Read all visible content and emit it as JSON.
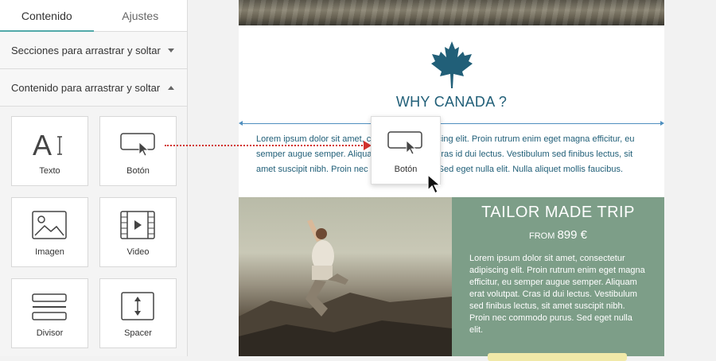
{
  "sidebar": {
    "tabs": [
      {
        "label": "Contenido",
        "active": true
      },
      {
        "label": "Ajustes",
        "active": false
      }
    ],
    "sections": [
      {
        "label": "Secciones para arrastrar y soltar",
        "caret": "chevron-down-icon"
      },
      {
        "label": "Contenido para arrastrar y soltar",
        "caret": "chevron-up-icon"
      }
    ],
    "blocks": [
      {
        "label": "Texto",
        "icon": "text-icon"
      },
      {
        "label": "Botón",
        "icon": "button-icon"
      },
      {
        "label": "Imagen",
        "icon": "image-icon"
      },
      {
        "label": "Video",
        "icon": "video-icon"
      },
      {
        "label": "Divisor",
        "icon": "divider-icon"
      },
      {
        "label": "Spacer",
        "icon": "spacer-icon"
      }
    ]
  },
  "email": {
    "heading": "WHY CANADA ?",
    "paragraph": "Lorem ipsum dolor sit amet, consectetur adipiscing elit. Proin rutrum enim eget magna efficitur, eu semper augue semper. Aliquam erat volutpat. Cras id dui lectus. Vestibulum sed finibus lectus, sit amet suscipit nibh. Proin nec commodo purus. Sed eget nulla elit. Nulla aliquet mollis faucibus.",
    "promo": {
      "title": "TAILOR MADE TRIP",
      "from_label": "FROM",
      "price": "899 €",
      "body": "Lorem ipsum dolor sit amet, consectetur adipiscing elit. Proin rutrum enim eget magna efficitur, eu semper augue semper. Aliquam erat volutpat. Cras id dui lectus. Vestibulum sed finibus lectus, sit amet suscipit nibh. Proin nec commodo purus. Sed eget nulla elit."
    },
    "accent_color": "#215f78",
    "panel_color": "#7d9e88"
  },
  "drag": {
    "ghost_label": "Botón",
    "ghost_icon": "button-icon",
    "arrow_color": "#d2322d"
  }
}
